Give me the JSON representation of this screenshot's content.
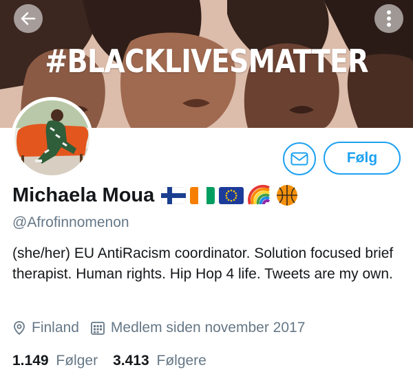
{
  "banner": {
    "text": "#BLACKLIVESMATTER"
  },
  "profile": {
    "name": "Michaela Moua",
    "handle": "@Afrofinnomenon",
    "bio": "(she/her) EU AntiRacism coordinator. Solution focused brief therapist. Human rights. Hip Hop 4 life. Tweets are my own.",
    "name_emojis": [
      "finland-flag",
      "ivory-coast-flag",
      "eu-flag",
      "rainbow-icon",
      "basketball-icon"
    ]
  },
  "actions": {
    "follow_label": "Følg"
  },
  "meta": {
    "location": "Finland",
    "joined": "Medlem siden november 2017"
  },
  "stats": {
    "following_count": "1.149",
    "following_label": "Følger",
    "followers_count": "3.413",
    "followers_label": "Følgere"
  },
  "colors": {
    "accent": "#1da1f2",
    "secondary_text": "#657786",
    "primary_text": "#14171a"
  }
}
